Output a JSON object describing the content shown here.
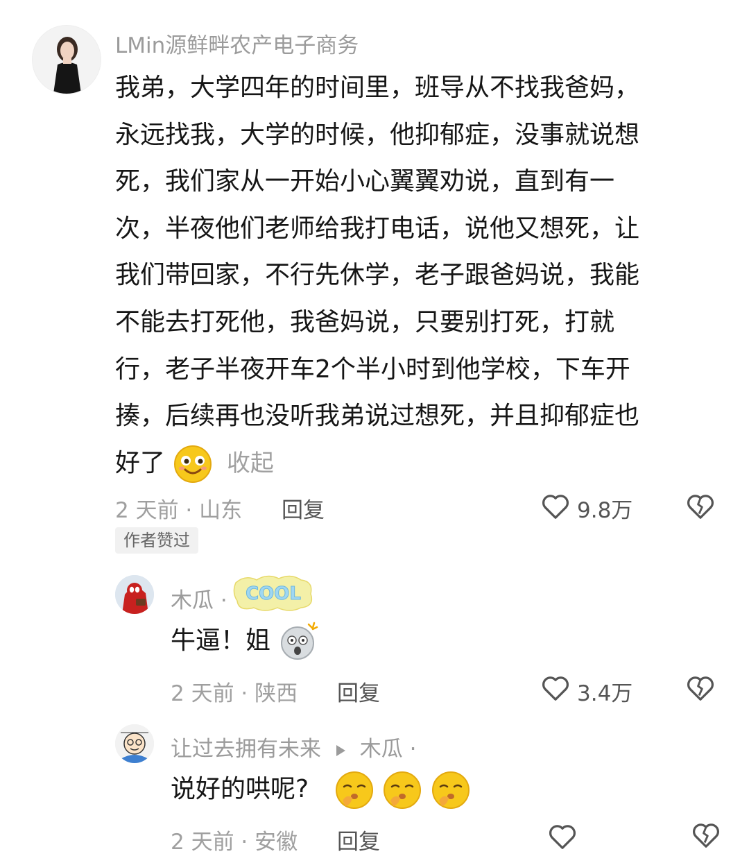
{
  "comments": [
    {
      "username": "LMin源鲜畔农产电子商务",
      "text_lines": [
        "我弟，大学四年的时间里，班导从不找我爸妈，",
        "永远找我，大学的时候，他抑郁症，没事就说想",
        "死，我们家从一开始小心翼翼劝说，直到有一",
        "次，半夜他们老师给我打电话，说他又想死，让",
        "我们带回家，不行先休学，老子跟爸妈说，我能",
        "不能去打死他，我爸妈说，只要别打死，打就",
        "行，老子半夜开车2个半小时到他学校，下车开",
        "揍，后续再也没听我弟说过想死，并且抑郁症也",
        "好了"
      ],
      "collapse_label": "收起",
      "time_location": "2 天前 · 山东",
      "reply_label": "回复",
      "likes": "9.8万",
      "author_badge": "作者赞过"
    },
    {
      "username": "木瓜 ·",
      "user_sticker": "cool",
      "text": "牛逼！姐",
      "time_location": "2 天前 · 陕西",
      "reply_label": "回复",
      "likes": "3.4万"
    },
    {
      "username": "让过去拥有未来",
      "reply_to": "木瓜 ·",
      "text": "说好的哄呢?",
      "time_location": "2 天前 · 安徽",
      "reply_label": "回复"
    }
  ],
  "colors": {
    "meta_gray": "#9f9f9f",
    "text_dark": "#161616",
    "emoji_yellow": "#f7c81b"
  }
}
